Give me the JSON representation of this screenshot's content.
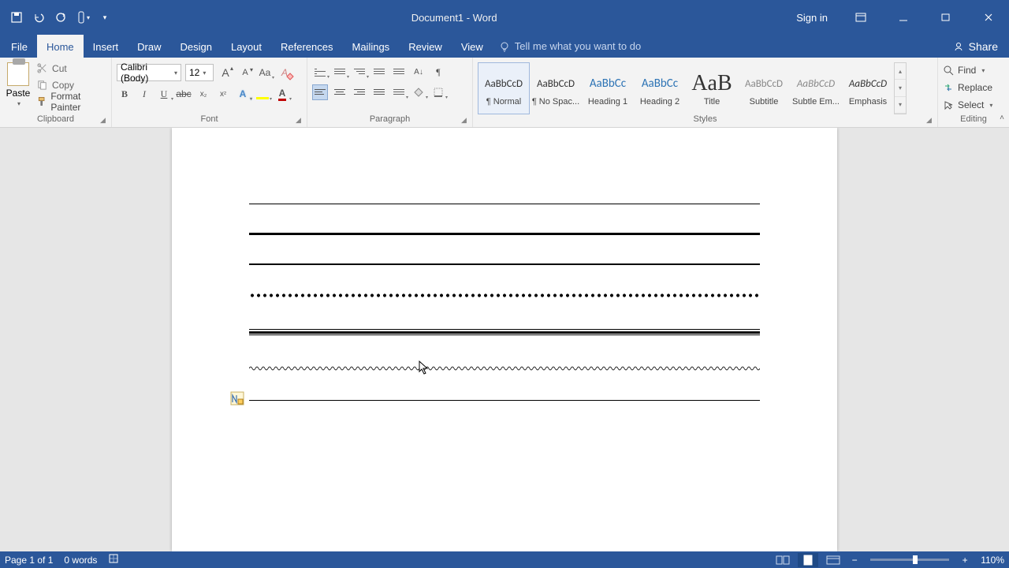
{
  "title": "Document1 - Word",
  "signin": "Sign in",
  "tabs": {
    "file": "File",
    "home": "Home",
    "insert": "Insert",
    "draw": "Draw",
    "design": "Design",
    "layout": "Layout",
    "references": "References",
    "mailings": "Mailings",
    "review": "Review",
    "view": "View"
  },
  "tellme_placeholder": "Tell me what you want to do",
  "share": "Share",
  "clipboard": {
    "paste": "Paste",
    "cut": "Cut",
    "copy": "Copy",
    "format_painter": "Format Painter",
    "group": "Clipboard"
  },
  "font": {
    "name_value": "Calibri (Body)",
    "size_value": "12",
    "group": "Font",
    "bold": "B",
    "italic": "I",
    "underline": "U",
    "strike": "abc",
    "sub": "x",
    "sup": "x",
    "case": "Aa",
    "clear": "A"
  },
  "paragraph": {
    "group": "Paragraph"
  },
  "styles": {
    "group": "Styles",
    "items": [
      {
        "preview": "AaBbCcD",
        "name": "¶ Normal",
        "cls": "",
        "sel": true
      },
      {
        "preview": "AaBbCcD",
        "name": "¶ No Spac...",
        "cls": ""
      },
      {
        "preview": "AaBbCc",
        "name": "Heading 1",
        "cls": "heading"
      },
      {
        "preview": "AaBbCc",
        "name": "Heading 2",
        "cls": "heading"
      },
      {
        "preview": "AaB",
        "name": "Title",
        "cls": "title"
      },
      {
        "preview": "AaBbCcD",
        "name": "Subtitle",
        "cls": "subtle"
      },
      {
        "preview": "AaBbCcD",
        "name": "Subtle Em...",
        "cls": "subtle emph"
      },
      {
        "preview": "AaBbCcD",
        "name": "Emphasis",
        "cls": "emph"
      }
    ]
  },
  "editing": {
    "find": "Find",
    "replace": "Replace",
    "select": "Select",
    "group": "Editing"
  },
  "status": {
    "page": "Page 1 of 1",
    "words": "0 words",
    "zoom": "110%"
  }
}
